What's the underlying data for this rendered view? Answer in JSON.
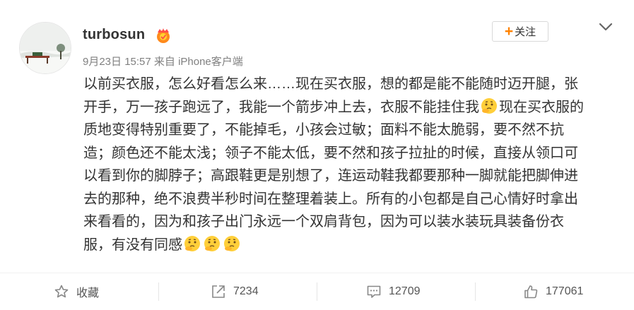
{
  "user": {
    "name": "turbosun",
    "meta": "9月23日 15:57 来自 iPhone客户端"
  },
  "follow": {
    "label": "关注"
  },
  "post": {
    "lines": [
      "以前买衣服，怎么好看怎么来……现在买衣服，想的都是能不能随时迈开腿，张",
      "开手，万一孩子跑远了，我能一个箭步冲上去，衣服不能挂住我",
      "现在买衣服的",
      "质地变得特别重要了，不能掉毛，小孩会过敏；面料不能太脆弱，要不然不抗",
      "造；颜色还不能太浅；领子不能太低，要不然和孩子拉扯的时候，直接从领口可",
      "以看到你的脚脖子；高跟鞋更是别想了，连运动鞋我都要那种一脚就能把脚伸进",
      "去的那种，绝不浪费半秒时间在整理着装上。所有的小包都是自己心情好时拿出",
      "来看看的，因为和孩子出门永远一个双肩背包，因为可以装水装玩具装备份衣",
      "服，有没有同感"
    ],
    "emoji_icon": "thinking-face-emoji-icon"
  },
  "actions": {
    "favorite": "收藏",
    "repost": "7234",
    "comment": "12709",
    "like": "177061"
  },
  "colors": {
    "accent": "#ff8200",
    "text": "#333333",
    "meta": "#808080"
  }
}
